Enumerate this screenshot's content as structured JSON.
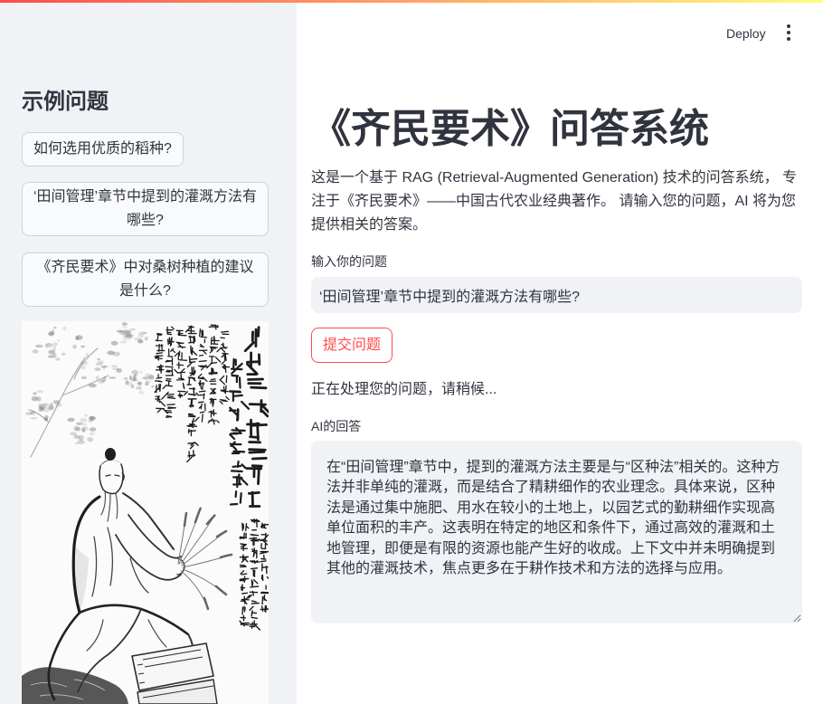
{
  "colors": {
    "primary": "#ff4b4b",
    "sidebar_bg": "#f0f2f6",
    "text": "#31333f",
    "field_bg": "#f0f2f6",
    "decoration_start": "#ff4b4b",
    "decoration_end": "#fffd80"
  },
  "header": {
    "deploy_label": "Deploy",
    "menu_icon": "more-vertical-icon"
  },
  "sidebar": {
    "heading": "示例问题",
    "example_buttons": [
      {
        "label": "如何选用优质的稻种?"
      },
      {
        "label": "‘田间管理’章节中提到的灌溉方法有哪些?"
      },
      {
        "label": "《齐民要术》中对桑树种植的建议是什么?"
      }
    ],
    "image": {
      "icon": "ink-painting-image"
    }
  },
  "main": {
    "title": "《齐民要术》问答系统",
    "description": "这是一个基于 RAG (Retrieval-Augmented Generation) 技术的问答系统， 专注于《齐民要术》——中国古代农业经典著作。 请输入您的问题，AI 将为您提供相关的答案。",
    "question_input": {
      "label": "输入你的问题",
      "value": "‘田间管理’章节中提到的灌溉方法有哪些?"
    },
    "submit_label": "提交问题",
    "status_text": "正在处理您的问题，请稍候...",
    "answer": {
      "label": "AI的回答",
      "value": "在“田间管理”章节中，提到的灌溉方法主要是与“区种法”相关的。这种方法并非单纯的灌溉，而是结合了精耕细作的农业理念。具体来说，区种法是通过集中施肥、用水在较小的土地上，以园艺式的勤耕细作实现高单位面积的丰产。这表明在特定的地区和条件下，通过高效的灌溉和土地管理，即便是有限的资源也能产生好的收成。上下文中并未明确提到其他的灌溉技术，焦点更多在于耕作技术和方法的选择与应用。"
    }
  }
}
